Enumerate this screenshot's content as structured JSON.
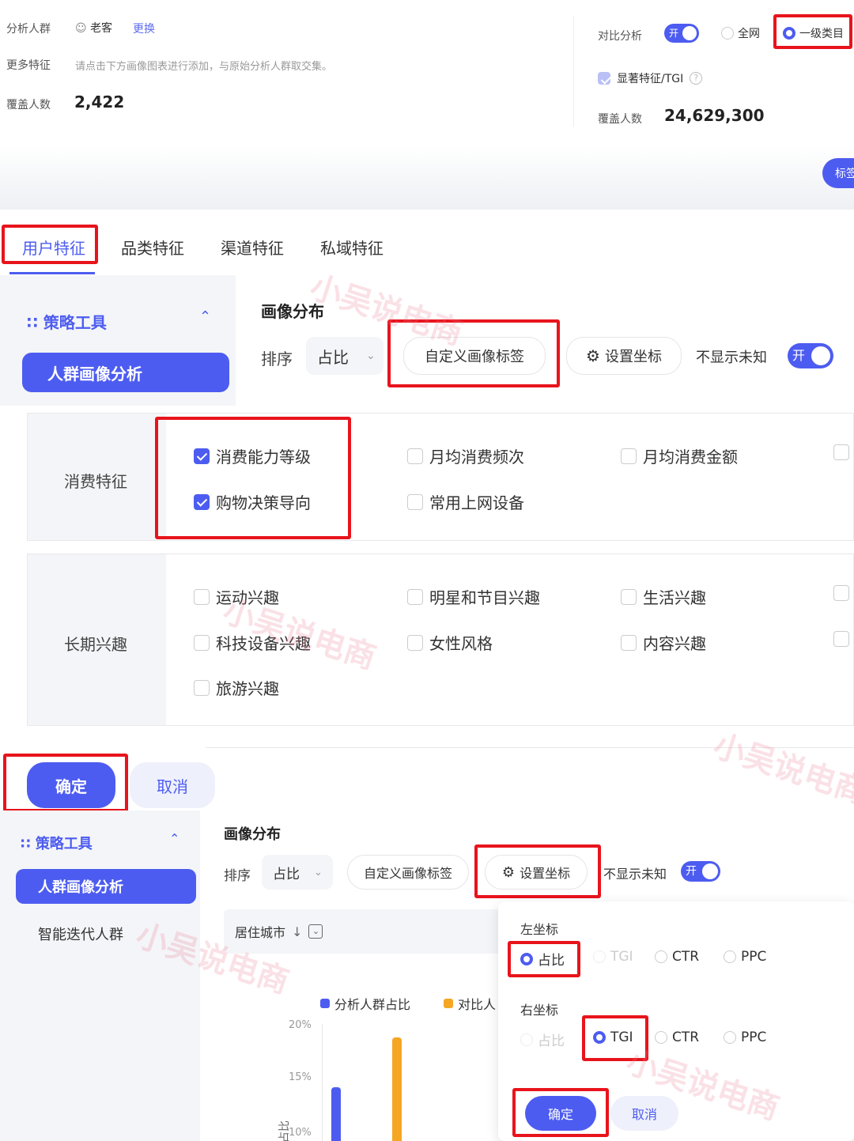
{
  "top": {
    "analysis_group_label": "分析人群",
    "group_name": "老客",
    "change_link": "更换",
    "more_features_label": "更多特征",
    "more_features_hint": "请点击下方画像图表进行添加，与原始分析人群取交集。",
    "coverage_label": "覆盖人数",
    "coverage_value": "2,422",
    "compare_label": "对比分析",
    "toggle_on": "开",
    "opt_all": "全网",
    "opt_level1": "一级类目",
    "significant_label": "显著特征/TGI",
    "coverage2_label": "覆盖人数",
    "coverage2_value": "24,629,300",
    "tag_button": "标签"
  },
  "tabs": [
    "用户特征",
    "品类特征",
    "渠道特征",
    "私域特征"
  ],
  "sidebar": {
    "section": "策略工具",
    "active_item": "人群画像分析",
    "item2": "智能迭代人群"
  },
  "toolbar": {
    "title": "画像分布",
    "sort_label": "排序",
    "sort_value": "占比",
    "custom_tag": "自定义画像标签",
    "set_axis": "设置坐标",
    "hide_unknown": "不显示未知",
    "toggle_on": "开"
  },
  "feature_groups": [
    {
      "name": "消费特征",
      "options": [
        {
          "label": "消费能力等级",
          "checked": true
        },
        {
          "label": "月均消费频次",
          "checked": false
        },
        {
          "label": "月均消费金额",
          "checked": false
        },
        {
          "label": "购物决策导向",
          "checked": true
        },
        {
          "label": "常用上网设备",
          "checked": false
        }
      ]
    },
    {
      "name": "长期兴趣",
      "options": [
        {
          "label": "运动兴趣",
          "checked": false
        },
        {
          "label": "明星和节目兴趣",
          "checked": false
        },
        {
          "label": "生活兴趣",
          "checked": false
        },
        {
          "label": "科技设备兴趣",
          "checked": false
        },
        {
          "label": "女性风格",
          "checked": false
        },
        {
          "label": "内容兴趣",
          "checked": false
        },
        {
          "label": "旅游兴趣",
          "checked": false
        }
      ]
    }
  ],
  "buttons": {
    "confirm": "确定",
    "cancel": "取消"
  },
  "chart_header": {
    "column": "居住城市"
  },
  "legend": [
    "分析人群占比",
    "对比人"
  ],
  "axis_ticks": [
    "20%",
    "15%",
    "10%"
  ],
  "axis_label": "占比",
  "axis_popup": {
    "left_title": "左坐标",
    "right_title": "右坐标",
    "options": [
      "占比",
      "TGI",
      "CTR",
      "PPC"
    ],
    "left_selected": "占比",
    "right_selected": "TGI",
    "confirm": "确定",
    "cancel": "取消"
  },
  "watermark": "小吴说电商",
  "colors": {
    "primary": "#4d5cf0",
    "orange": "#f5a623",
    "highlight": "#e8141c"
  }
}
